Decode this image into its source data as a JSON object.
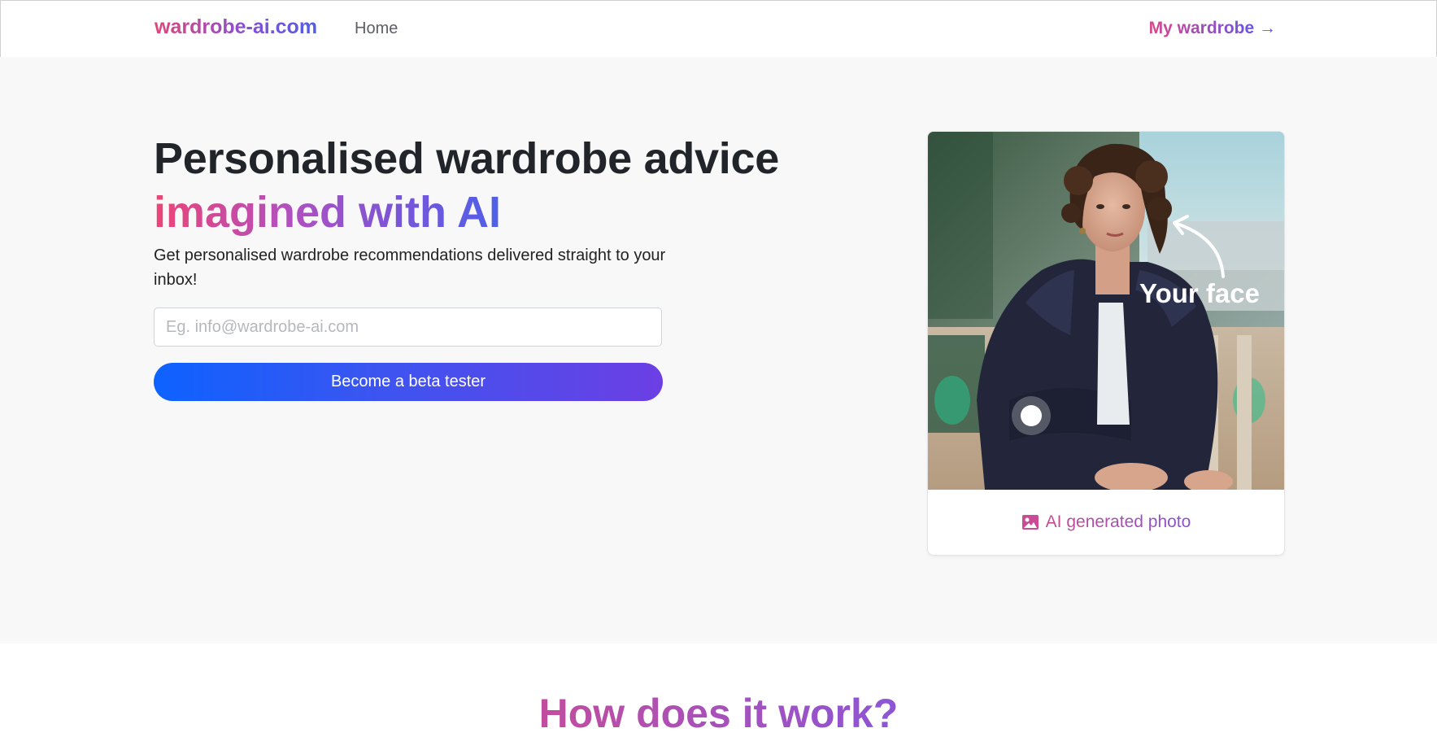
{
  "nav": {
    "brand": "wardrobe-ai.com",
    "home": "Home",
    "my_wardrobe": "My wardrobe →"
  },
  "hero": {
    "title_line1": "Personalised wardrobe advice",
    "title_line2": "imagined with AI",
    "subtitle": "Get personalised wardrobe recommendations delivered straight to your inbox!",
    "email_placeholder": "Eg. info@wardrobe-ai.com",
    "email_value": "",
    "cta_label": "Become a beta tester"
  },
  "card": {
    "overlay_text": "Your face",
    "caption": "AI generated photo",
    "caption_icon": "image-icon"
  },
  "section2": {
    "title": "How does it work?"
  },
  "colors": {
    "brand_pink": "#e0457b",
    "brand_purple": "#8a4fd0",
    "brand_blue": "#4f5ee8",
    "cta_start": "#0d62ff",
    "cta_end": "#6c3fe4"
  }
}
